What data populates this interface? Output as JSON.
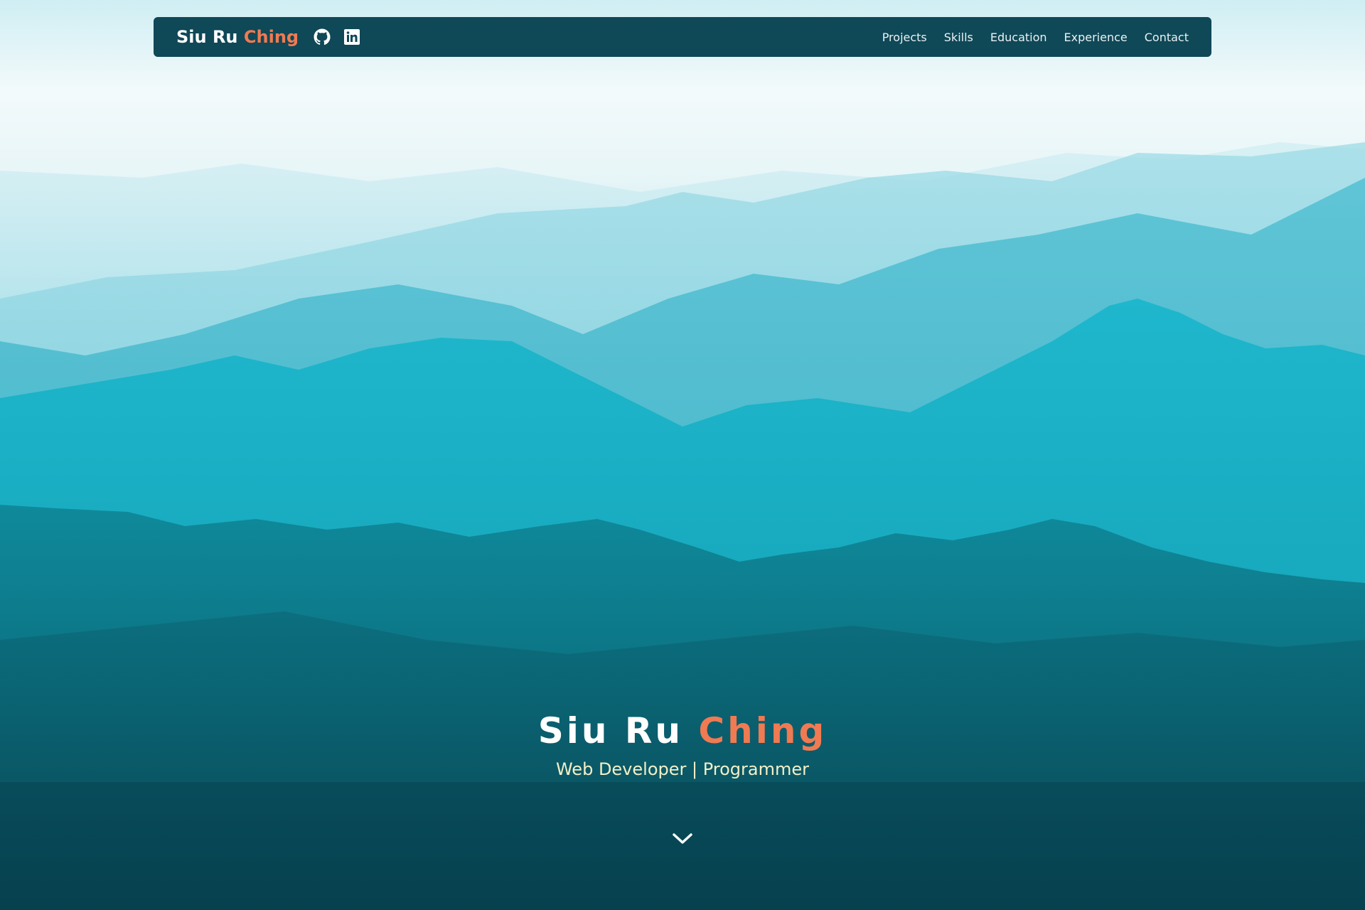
{
  "navbar": {
    "brand": {
      "first": "Siu Ru",
      "accent": "Ching"
    },
    "social": [
      {
        "icon": "github-icon"
      },
      {
        "icon": "linkedin-icon"
      }
    ],
    "links": [
      "Projects",
      "Skills",
      "Education",
      "Experience",
      "Contact"
    ]
  },
  "hero": {
    "title_first": "Siu Ru",
    "title_accent": "Ching",
    "subtitle": "Web Developer | Programmer",
    "scroll_icon": "chevron-down-icon"
  },
  "colors": {
    "navbar_bg": "#0f4857",
    "accent": "#f07a52",
    "subtitle": "#f4efc6",
    "text": "#ffffff"
  }
}
